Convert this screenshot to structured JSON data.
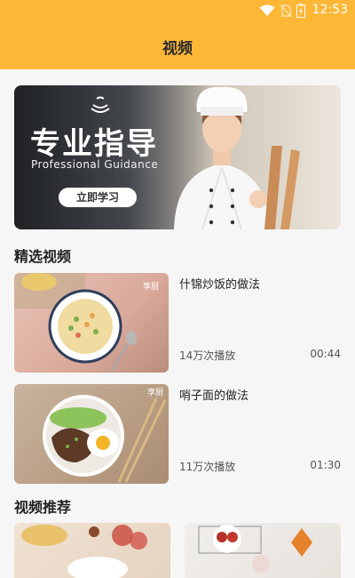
{
  "status_bar": {
    "time": "12:53"
  },
  "header": {
    "title": "视频"
  },
  "banner": {
    "title": "专业指导",
    "subtitle": "Professional Guidance",
    "button_label": "立即学习"
  },
  "featured": {
    "section_title": "精选视频",
    "videos": [
      {
        "title": "什锦炒饭的做法",
        "plays": "14万次播放",
        "duration": "00:44"
      },
      {
        "title": "哨子面的做法",
        "plays": "11万次播放",
        "duration": "01:30"
      }
    ]
  },
  "recommend": {
    "section_title": "视频推荐"
  },
  "colors": {
    "header": "#fcb737",
    "background": "#f6f6f6"
  }
}
